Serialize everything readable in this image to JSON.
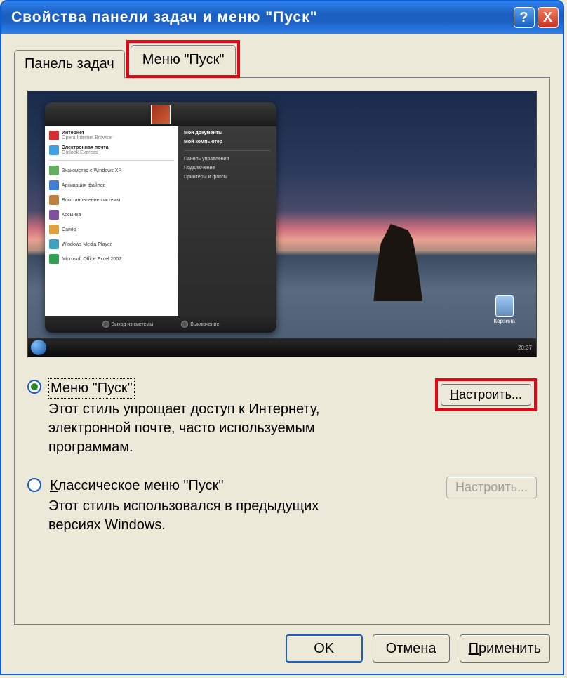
{
  "title": "Свойства панели задач и меню \"Пуск\"",
  "titlebar": {
    "help_glyph": "?",
    "close_glyph": "X"
  },
  "tabs": {
    "taskbar": "Панель задач",
    "startmenu": "Меню \"Пуск\""
  },
  "preview": {
    "recyclebin_label": "Корзина",
    "sm_left": [
      {
        "title": "Интернет",
        "sub": "Opera Internet Browser",
        "color": "#d03030"
      },
      {
        "title": "Электронная почта",
        "sub": "Outlook Express",
        "color": "#40a0e0"
      },
      {
        "title": "Знакомство с Windows XP",
        "sub": "",
        "color": "#60b060"
      },
      {
        "title": "Архивация файлов",
        "sub": "",
        "color": "#4080d0"
      },
      {
        "title": "Восстановление системы",
        "sub": "",
        "color": "#c08040"
      },
      {
        "title": "Косынка",
        "sub": "",
        "color": "#8050a0"
      },
      {
        "title": "Сапёр",
        "sub": "",
        "color": "#e0a040"
      },
      {
        "title": "Windows Media Player",
        "sub": "",
        "color": "#40a0c0"
      },
      {
        "title": "Microsoft Office Excel 2007",
        "sub": "",
        "color": "#30a050"
      }
    ],
    "sm_right": [
      "Мои документы",
      "Мой компьютер",
      "Панель управления",
      "Подключение",
      "Принтеры и факсы"
    ],
    "sm_bottom": {
      "left": "Выход из системы",
      "right": "Выключение"
    },
    "taskbar_time": "20:37"
  },
  "options": {
    "modern": {
      "title": "Меню \"Пуск\"",
      "desc": "Этот стиль упрощает доступ к Интернету, электронной почте, часто используемым программам.",
      "customize": "Настроить..."
    },
    "classic": {
      "title_prefix": "К",
      "title_rest": "лассическое меню \"Пуск\"",
      "desc": "Этот стиль использовался в предыдущих версиях Windows.",
      "customize": "Настроить..."
    }
  },
  "buttons": {
    "ok": "OK",
    "cancel": "Отмена",
    "apply_prefix": "П",
    "apply_rest": "рименить"
  }
}
